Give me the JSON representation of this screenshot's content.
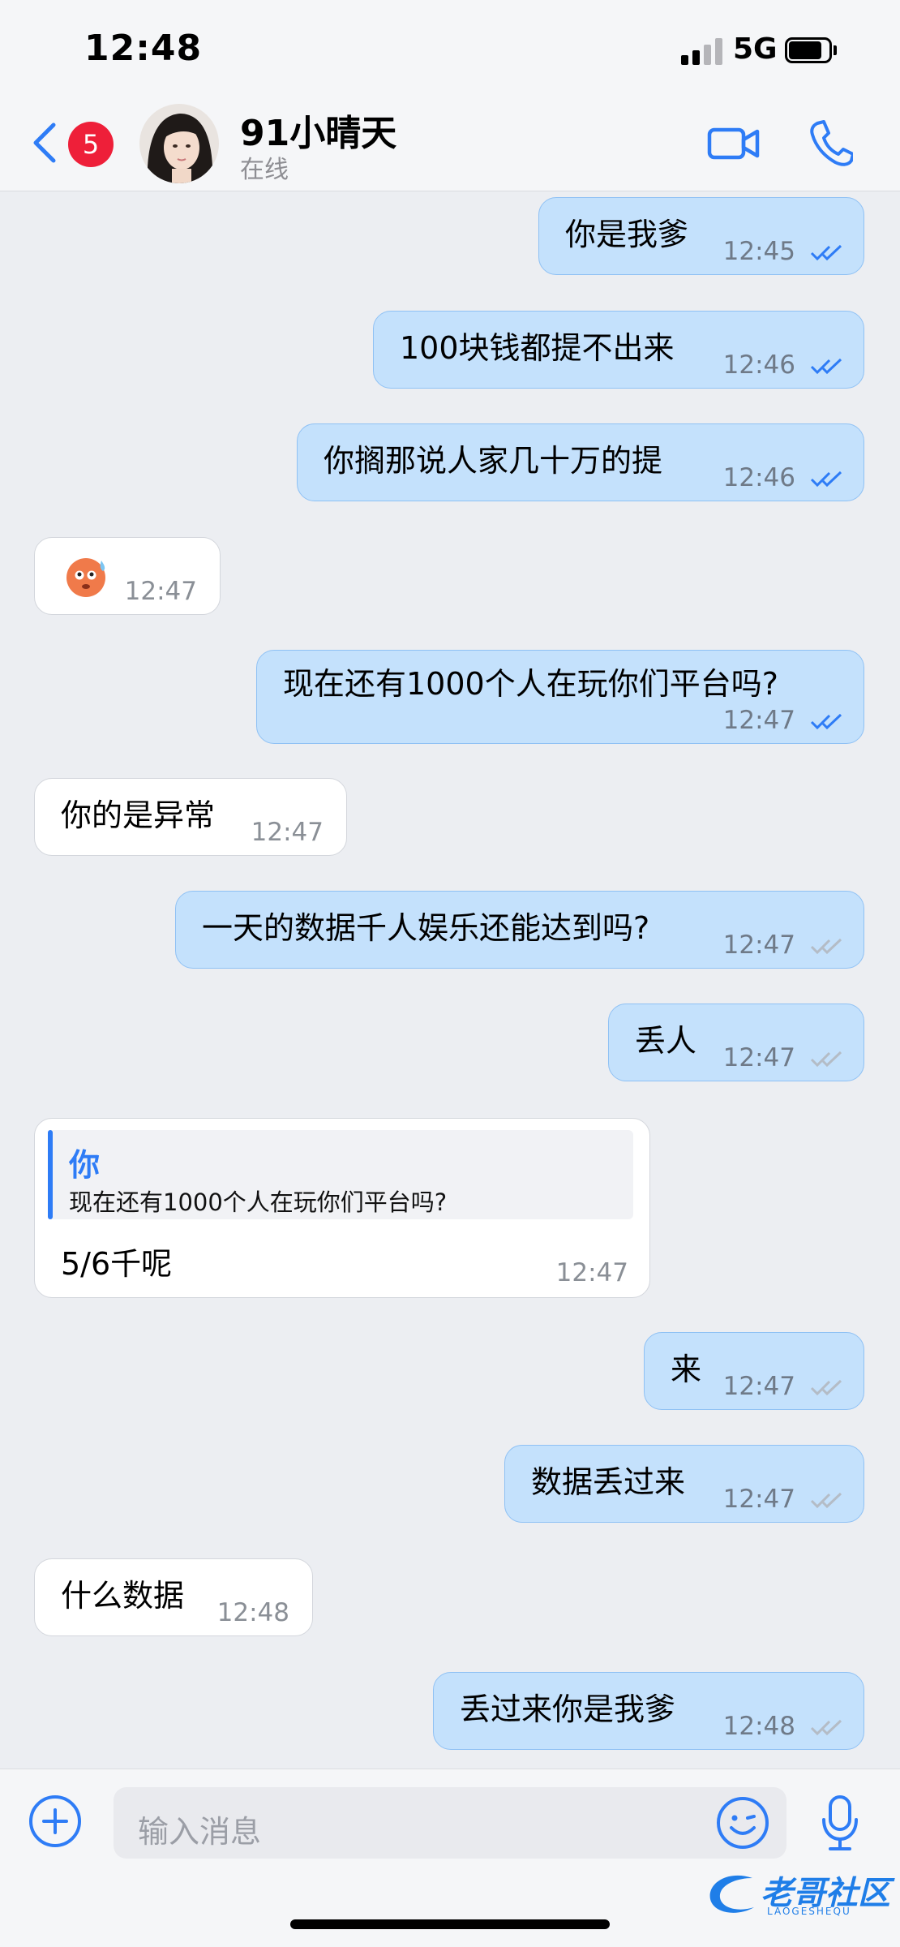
{
  "status_bar": {
    "time": "12:48",
    "network": "5G"
  },
  "header": {
    "unread_count": "5",
    "contact_name": "91小晴天",
    "contact_status": "在线"
  },
  "messages": [
    {
      "side": "out",
      "text": "你是我爹",
      "time": "12:45",
      "read": true
    },
    {
      "side": "out",
      "text": "100块钱都提不出来",
      "time": "12:46",
      "read": true
    },
    {
      "side": "out",
      "text": "你搁那说人家几十万的提",
      "time": "12:46",
      "read": true
    },
    {
      "side": "in",
      "text": "",
      "emoji": "face-with-rolling-eyes-sweat",
      "time": "12:47"
    },
    {
      "side": "out",
      "text": "现在还有1000个人在玩你们平台吗?",
      "time": "12:47",
      "read": true
    },
    {
      "side": "in",
      "text": "你的是异常",
      "time": "12:47"
    },
    {
      "side": "out",
      "text": "一天的数据千人娱乐还能达到吗?",
      "time": "12:47",
      "read": false
    },
    {
      "side": "out",
      "text": "丢人",
      "time": "12:47",
      "read": false
    },
    {
      "side": "in",
      "quote": {
        "author": "你",
        "text": "现在还有1000个人在玩你们平台吗?"
      },
      "text": "5/6千呢",
      "time": "12:47"
    },
    {
      "side": "out",
      "text": "来",
      "time": "12:47",
      "read": false
    },
    {
      "side": "out",
      "text": "数据丢过来",
      "time": "12:47",
      "read": false
    },
    {
      "side": "in",
      "text": "什么数据",
      "time": "12:48"
    },
    {
      "side": "out",
      "text": "丢过来你是我爹",
      "time": "12:48",
      "read": false
    }
  ],
  "composer": {
    "placeholder": "输入消息"
  },
  "watermark": {
    "text": "老哥社区",
    "sub": "LAOGESHEQU"
  },
  "colors": {
    "accent": "#2e7cf6",
    "outgoing_bubble": "#c4e1fc",
    "incoming_bubble": "#ffffff",
    "badge": "#ee1f39"
  }
}
